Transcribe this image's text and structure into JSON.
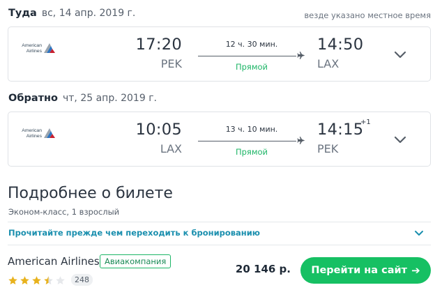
{
  "outbound": {
    "title": "Туда",
    "date": "вс, 14 апр. 2019 г.",
    "airline_logo_text": [
      "American",
      "Airlines"
    ],
    "dep_time": "17:20",
    "dep_code": "PEK",
    "duration": "12 ч. 30 мин.",
    "stops": "Прямой",
    "arr_time": "14:50",
    "arr_code": "LAX"
  },
  "timezone_note": "везде указано местное время",
  "return": {
    "title": "Обратно",
    "date": "чт, 25 апр. 2019 г.",
    "airline_logo_text": [
      "American",
      "Airlines"
    ],
    "dep_time": "10:05",
    "dep_code": "LAX",
    "duration": "13 ч. 10 мин.",
    "stops": "Прямой",
    "arr_time": "14:15",
    "arr_day_offset": "+1",
    "arr_code": "PEK"
  },
  "details": {
    "title": "Подробнее о билете",
    "subtitle": "Эконом-класс, 1 взрослый",
    "read_before": "Прочитайте прежде чем переходить к бронированию"
  },
  "offer": {
    "agent_name": "American Airlines",
    "agent_badge": "Авиакомпания",
    "rating_stars": 3.5,
    "rating_max": 5,
    "rating_count": "248",
    "price": "20 146 р.",
    "cta": "Перейти на сайт",
    "cta_arrow": "➔"
  },
  "icons": {
    "plane": "plane-icon",
    "expand": "chevron-down-icon",
    "star": "star-icon"
  },
  "colors": {
    "accent_green": "#16c063",
    "direct_green": "#1cb566",
    "link_teal": "#1a8fae",
    "star_gold": "#e8b21d",
    "star_empty": "#dfe2e6"
  }
}
